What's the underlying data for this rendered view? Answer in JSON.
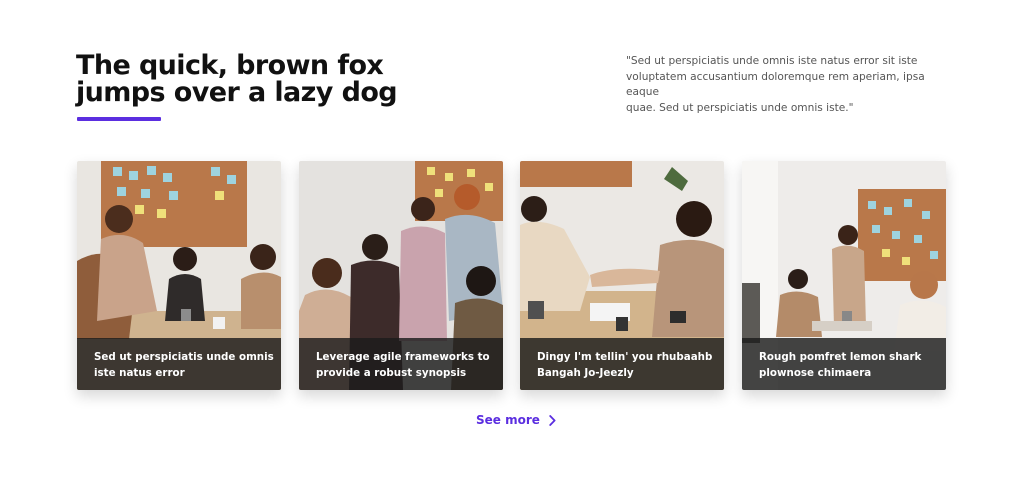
{
  "section": {
    "title_lines": [
      "The quick, brown fox",
      "jumps over a lazy dog"
    ],
    "quote_lines": [
      "\"Sed ut perspiciatis unde omnis iste natus error sit iste",
      "voluptatem accusantium doloremque rem aperiam, ipsa eaque",
      "quae. Sed ut perspiciatis unde omnis iste.\""
    ],
    "accent_color": "#5b2ee0"
  },
  "cards": [
    {
      "image": "team-meeting-handshake-photo",
      "caption_lines": [
        "Sed ut perspiciatis unde omnis",
        "iste natus error"
      ]
    },
    {
      "image": "team-group-hug-photo",
      "caption_lines": [
        "Leverage agile frameworks to",
        "provide a robust synopsis"
      ]
    },
    {
      "image": "office-handshake-photo",
      "caption_lines": [
        "Dingy I'm tellin' you rhubaahb",
        "Bangah Jo-Jeezly"
      ]
    },
    {
      "image": "office-whiteboard-meeting-photo",
      "caption_lines": [
        "Rough pomfret lemon shark",
        "plownose chimaera"
      ]
    }
  ],
  "see_more": {
    "label": "See more",
    "icon": "chevron-right-icon"
  }
}
